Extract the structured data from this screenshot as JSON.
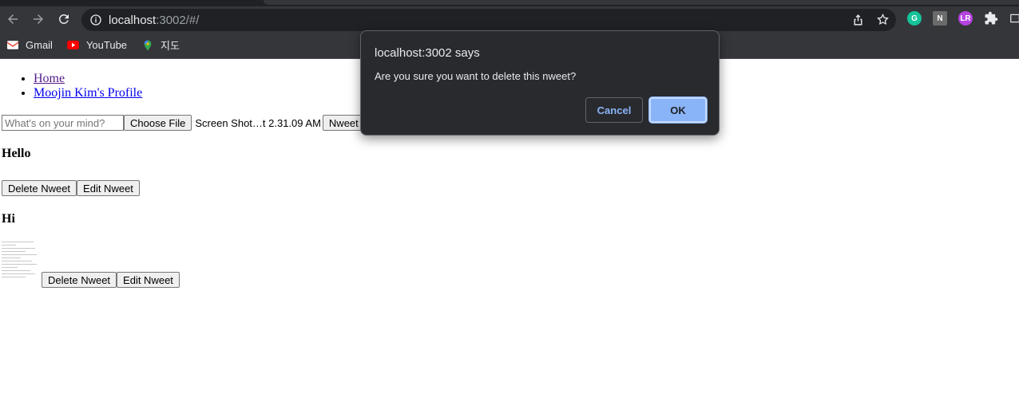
{
  "browser": {
    "url_host": "localhost",
    "url_path": ":3002/#/",
    "bookmarks": [
      {
        "label": "Gmail",
        "icon": "gmail-icon"
      },
      {
        "label": "YouTube",
        "icon": "youtube-icon"
      },
      {
        "label": "지도",
        "icon": "maps-icon"
      }
    ],
    "extensions": [
      {
        "label": "G",
        "color": "#15c39a"
      },
      {
        "label": "N",
        "color": "#6b6b6b"
      },
      {
        "label": "LR",
        "color": "#b543e0"
      }
    ]
  },
  "nav": {
    "home": "Home",
    "profile": "Moojin Kim's Profile"
  },
  "form": {
    "placeholder": "What's on your mind?",
    "choose_file": "Choose File",
    "file_name": "Screen Shot…t 2.31.09 AM",
    "submit": "Nweet"
  },
  "nweets": [
    {
      "text": "Hello",
      "delete_label": "Delete Nweet",
      "edit_label": "Edit Nweet"
    },
    {
      "text": "Hi",
      "delete_label": "Delete Nweet",
      "edit_label": "Edit Nweet"
    }
  ],
  "dialog": {
    "title": "localhost:3002 says",
    "message": "Are you sure you want to delete this nweet?",
    "cancel": "Cancel",
    "ok": "OK"
  }
}
